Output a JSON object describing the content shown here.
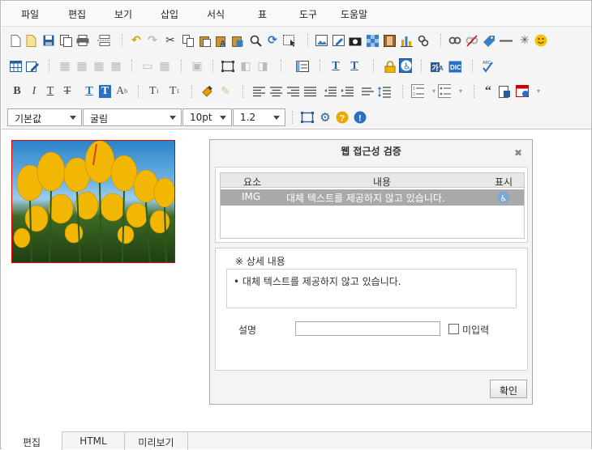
{
  "menubar": {
    "items": [
      "파일",
      "편집",
      "보기",
      "삽입",
      "서식",
      "표",
      "도구",
      "도움말"
    ]
  },
  "toolbar": {
    "font_style": "기본값",
    "font_family": "굴림",
    "font_size": "10pt",
    "line_height": "1.2"
  },
  "dialog": {
    "title": "웹 접근성 검증",
    "close": "✖",
    "table": {
      "headers": [
        "요소",
        "내용",
        "표시"
      ],
      "rows": [
        {
          "element": "IMG",
          "content": "대체 텍스트를 제공하지 않고 있습니다.",
          "icon": "accessibility-icon"
        }
      ]
    },
    "detail": {
      "title": "※ 상세 내용",
      "items": [
        "대체 텍스트를 제공하지 않고 있습니다."
      ]
    },
    "description_label": "설명",
    "description_value": "",
    "no_input_label": "미입력",
    "confirm_label": "확인"
  },
  "tabs": [
    "편집",
    "HTML",
    "미리보기"
  ],
  "colors": {
    "accent_blue": "#3a7fc1",
    "selected_row": "#a9a9a9",
    "image_border": "#dd0000"
  }
}
